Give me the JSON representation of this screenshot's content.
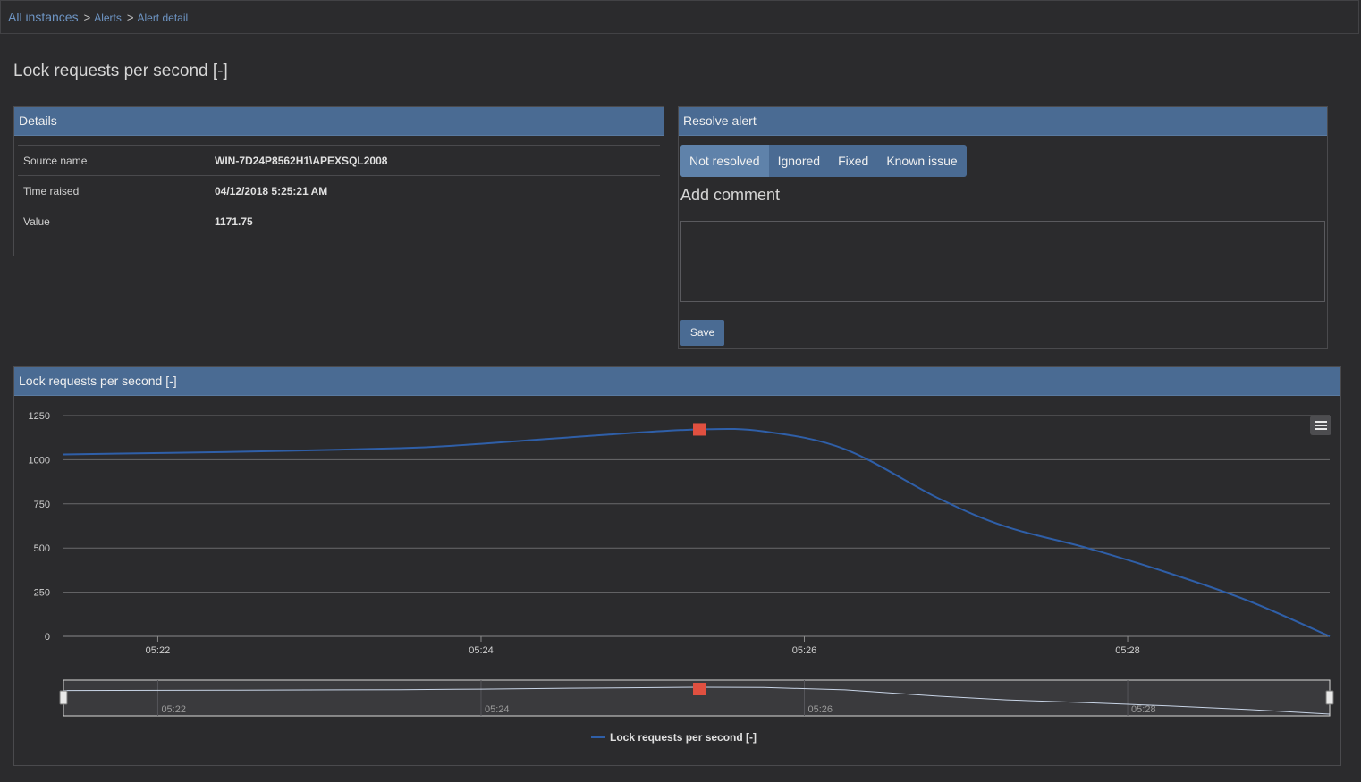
{
  "breadcrumb": {
    "items": [
      "All instances",
      "Alerts",
      "Alert detail"
    ]
  },
  "page_title": "Lock requests per second [-]",
  "details": {
    "title": "Details",
    "rows": [
      {
        "label": "Source name",
        "value": "WIN-7D24P8562H1\\APEXSQL2008"
      },
      {
        "label": "Time raised",
        "value": "04/12/2018 5:25:21 AM"
      },
      {
        "label": "Value",
        "value": "1171.75"
      }
    ]
  },
  "resolve": {
    "title": "Resolve alert",
    "options": [
      "Not resolved",
      "Ignored",
      "Fixed",
      "Known issue"
    ],
    "selected": "Not resolved",
    "add_comment_label": "Add comment",
    "comment_value": "",
    "save_label": "Save"
  },
  "chart_panel": {
    "title": "Lock requests per second [-]",
    "menu_icon": "hamburger-menu-icon"
  },
  "chart_data": {
    "type": "line",
    "series": [
      {
        "name": "Lock requests per second [-]",
        "color": "#2f5fa8",
        "points": [
          {
            "x": "05:21:25",
            "y": 1030
          },
          {
            "x": "05:22:30",
            "y": 1045
          },
          {
            "x": "05:23:30",
            "y": 1065
          },
          {
            "x": "05:24:00",
            "y": 1090
          },
          {
            "x": "05:24:45",
            "y": 1140
          },
          {
            "x": "05:25:21",
            "y": 1171.75
          },
          {
            "x": "05:25:45",
            "y": 1160
          },
          {
            "x": "05:26:15",
            "y": 1060
          },
          {
            "x": "05:26:50",
            "y": 780
          },
          {
            "x": "05:27:15",
            "y": 620
          },
          {
            "x": "05:27:45",
            "y": 500
          },
          {
            "x": "05:28:15",
            "y": 360
          },
          {
            "x": "05:28:45",
            "y": 200
          },
          {
            "x": "05:29:15",
            "y": 0
          }
        ]
      }
    ],
    "highlight": {
      "x": "05:25:21",
      "y": 1171.75,
      "color": "#e05040"
    },
    "x_ticks": [
      "05:22",
      "05:24",
      "05:26",
      "05:28"
    ],
    "y_ticks": [
      0,
      250,
      500,
      750,
      1000,
      1250
    ],
    "ylim": [
      0,
      1250
    ],
    "xlim": [
      "05:21:25",
      "05:29:15"
    ],
    "grid": true,
    "legend_position": "bottom-center",
    "navigator": true
  }
}
